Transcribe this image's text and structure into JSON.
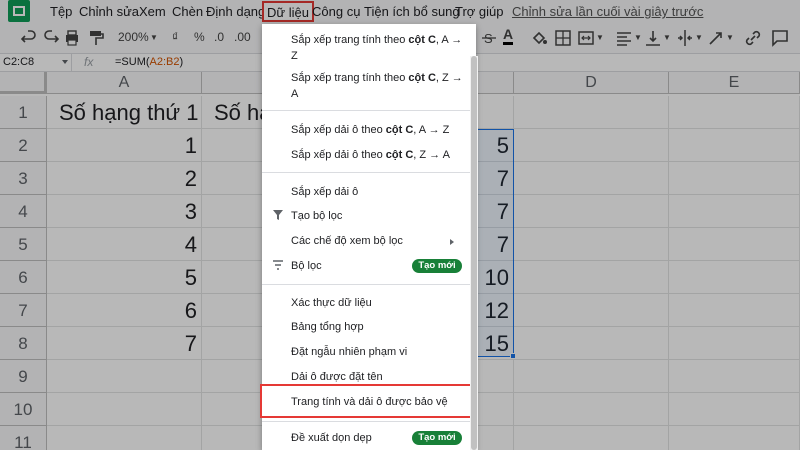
{
  "menubar": {
    "items": [
      "Tệp",
      "Chỉnh sửa",
      "Xem",
      "Chèn",
      "Định dạng",
      "Dữ liệu",
      "Công cụ",
      "Tiện ích bổ sung",
      "Trợ giúp"
    ],
    "last_edit": "Chỉnh sửa lần cuối vài giây trước"
  },
  "toolbar": {
    "zoom": "200%",
    "currency": "₫",
    "percent": "%",
    "dec_decrease": ".0",
    "dec_increase": ".00",
    "text_color_label": "A"
  },
  "formula_bar": {
    "name_box": "C2:C8",
    "fx": "fx",
    "formula_prefix": "=SUM(",
    "formula_ref": "A2:B2",
    "formula_suffix": ")"
  },
  "grid": {
    "columns": [
      "A",
      "B",
      "C",
      "D",
      "E"
    ],
    "rows": [
      "1",
      "2",
      "3",
      "4",
      "5",
      "6",
      "7",
      "8",
      "9",
      "10",
      "11"
    ],
    "header_a": "Số hạng thứ 1",
    "header_b": "Số hạ",
    "col_a_values": [
      "1",
      "2",
      "3",
      "4",
      "5",
      "6",
      "7"
    ],
    "col_c_values": [
      "5",
      "7",
      "7",
      "7",
      "10",
      "12",
      "15"
    ]
  },
  "dropdown": {
    "sort_sheet_az_1": "Sắp xếp trang tính theo ",
    "sort_sheet_az_bold": "cột C",
    "sort_sheet_az_2": ", A → Z",
    "sort_sheet_za_1": "Sắp xếp trang tính theo ",
    "sort_sheet_za_bold": "cột C",
    "sort_sheet_za_2": ", Z → A",
    "sort_range_az_1": "Sắp xếp dải ô theo ",
    "sort_range_az_bold": "cột C",
    "sort_range_az_2": ", A → Z",
    "sort_range_za_1": "Sắp xếp dải ô theo ",
    "sort_range_za_bold": "cột C",
    "sort_range_za_2": ", Z → A",
    "sort_range": "Sắp xếp dải ô",
    "create_filter": "Tạo bộ lọc",
    "filter_views": "Các chế độ xem bộ lọc",
    "slicer": "Bộ lọc",
    "new_badge": "Tạo mới",
    "data_validation": "Xác thực dữ liệu",
    "pivot_table": "Bảng tổng hợp",
    "randomize_range": "Đặt ngẫu nhiên phạm vi",
    "named_ranges": "Dải ô được đặt tên",
    "protected_ranges": "Trang tính và dải ô được bảo vệ",
    "cleanup": "Đề xuất dọn dẹp",
    "new_badge_2": "Tạo mới"
  },
  "colors": {
    "accent": "#1a73e8",
    "highlight": "#e53935",
    "badge": "#188038",
    "logo": "#0f9d58"
  }
}
